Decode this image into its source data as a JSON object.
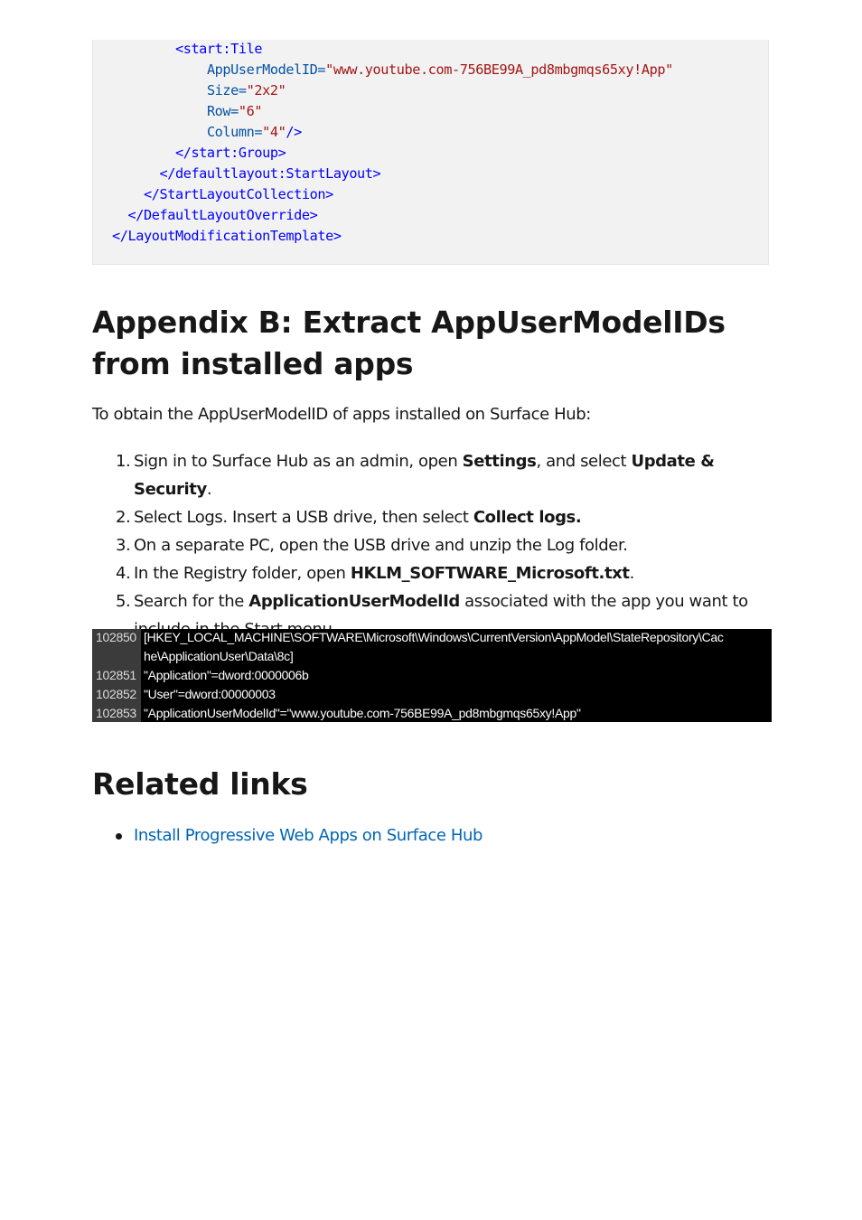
{
  "code_block": {
    "lines": [
      {
        "indent": "        ",
        "tag_open": "<start:Tile",
        "attr": "",
        "value": "",
        "tag_close": ""
      },
      {
        "indent": "            ",
        "tag_open": "",
        "attr": "AppUserModelID=",
        "value": "\"www.youtube.com-756BE99A_pd8mbgmqs65xy!App\"",
        "tag_close": ""
      },
      {
        "indent": "            ",
        "tag_open": "",
        "attr": "Size=",
        "value": "\"2x2\"",
        "tag_close": ""
      },
      {
        "indent": "            ",
        "tag_open": "",
        "attr": "Row=",
        "value": "\"6\"",
        "tag_close": ""
      },
      {
        "indent": "            ",
        "tag_open": "",
        "attr": "Column=",
        "value": "\"4\"",
        "tag_close": "/>"
      },
      {
        "indent": "        ",
        "tag_open": "</start:Group>",
        "attr": "",
        "value": "",
        "tag_close": ""
      },
      {
        "indent": "      ",
        "tag_open": "</defaultlayout:StartLayout>",
        "attr": "",
        "value": "",
        "tag_close": ""
      },
      {
        "indent": "    ",
        "tag_open": "</StartLayoutCollection>",
        "attr": "",
        "value": "",
        "tag_close": ""
      },
      {
        "indent": "  ",
        "tag_open": "</DefaultLayoutOverride>",
        "attr": "",
        "value": "",
        "tag_close": ""
      },
      {
        "indent": "",
        "tag_open": "</LayoutModificationTemplate>",
        "attr": "",
        "value": "",
        "tag_close": ""
      }
    ]
  },
  "appendix": {
    "heading": "Appendix B: Extract AppUserModelIDs from installed apps",
    "intro": "To obtain the AppUserModelID of apps installed on Surface Hub:",
    "steps": [
      {
        "num": "1.",
        "parts": [
          {
            "t": "Sign in to Surface Hub as an admin, open ",
            "b": false
          },
          {
            "t": "Settings",
            "b": true
          },
          {
            "t": ", and select ",
            "b": false
          },
          {
            "t": "Update & Security",
            "b": true
          },
          {
            "t": ".",
            "b": false
          }
        ]
      },
      {
        "num": "2.",
        "parts": [
          {
            "t": "Select Logs. Insert a USB drive, then select ",
            "b": false
          },
          {
            "t": "Collect logs.",
            "b": true
          }
        ]
      },
      {
        "num": "3.",
        "parts": [
          {
            "t": "On a separate PC, open the USB drive and unzip the Log folder.",
            "b": false
          }
        ]
      },
      {
        "num": "4.",
        "parts": [
          {
            "t": "In the Registry folder, open ",
            "b": false
          },
          {
            "t": "HKLM_SOFTWARE_Microsoft.txt",
            "b": true
          },
          {
            "t": ".",
            "b": false
          }
        ]
      },
      {
        "num": "5.",
        "parts": [
          {
            "t": "Search for the ",
            "b": false
          },
          {
            "t": "ApplicationUserModelId",
            "b": true
          },
          {
            "t": " associated with the app you want to include in the Start menu.",
            "b": false
          }
        ]
      }
    ]
  },
  "registry_screenshot": {
    "rows": [
      {
        "num": "102850",
        "text": "[HKEY_LOCAL_MACHINE\\SOFTWARE\\Microsoft\\Windows\\CurrentVersion\\AppModel\\StateRepository\\Cac"
      },
      {
        "num": "",
        "text": "he\\ApplicationUser\\Data\\8c]"
      },
      {
        "num": "102851",
        "text": "\"Application\"=dword:0000006b"
      },
      {
        "num": "102852",
        "text": "\"User\"=dword:00000003"
      },
      {
        "num": "102853",
        "text": "\"ApplicationUserModelId\"=\"www.youtube.com-756BE99A_pd8mbgmqs65xy!App\""
      }
    ]
  },
  "related": {
    "heading": "Related links",
    "links": [
      {
        "label": "Install Progressive Web Apps on Surface Hub"
      }
    ]
  },
  "colors": {
    "link": "#0065b3",
    "code_tag": "#0101fd",
    "code_attr": "#0451a5",
    "code_value": "#a31515"
  }
}
